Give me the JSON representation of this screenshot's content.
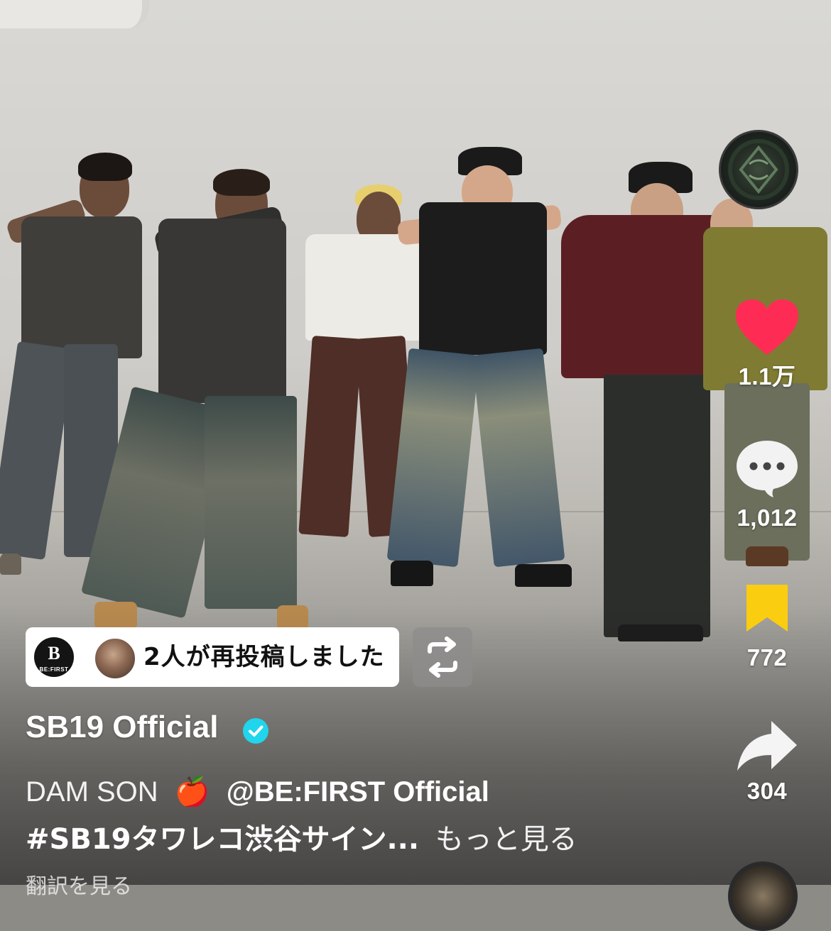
{
  "actions": {
    "like_count": "1.1万",
    "comment_count": "1,012",
    "bookmark_count": "772",
    "share_count": "304",
    "like_color": "#fe2c55",
    "bookmark_color": "#facd10"
  },
  "repost": {
    "label": "2人が再投稿しました",
    "avatar_logo_text": "B",
    "avatar_logo_sub": "BE:FIRST"
  },
  "author": {
    "name": "SB19 Official",
    "verified": true,
    "verified_color": "#20d5ec"
  },
  "caption": {
    "sound_text": "DAM SON",
    "emoji": "🍎",
    "mention": "@BE:FIRST Official",
    "hashtag": "#SB19タワレコ渋谷サイン...",
    "more_label": "もっと見る",
    "translate_label": "翻訳を見る"
  },
  "icons": [
    "heart-icon",
    "comment-bubble-icon",
    "bookmark-icon",
    "share-arrow-icon",
    "repost-icon",
    "verified-check-icon",
    "profile-avatar",
    "music-disc-icon"
  ]
}
